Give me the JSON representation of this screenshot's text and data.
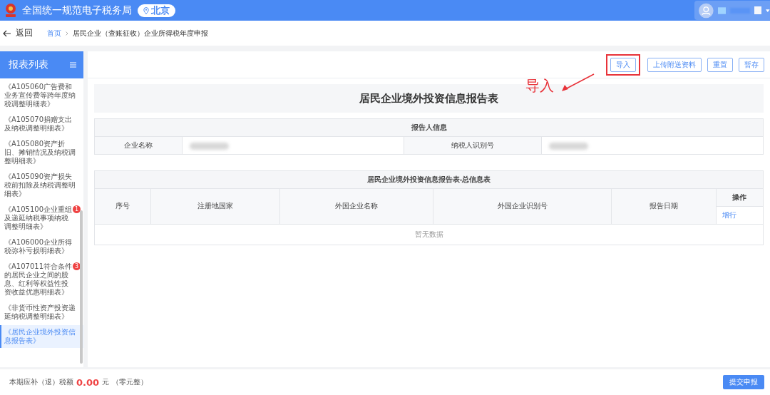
{
  "header": {
    "title": "全国统一规范电子税务局",
    "location": "北京"
  },
  "nav": {
    "back": "返回",
    "breadcrumb": [
      {
        "label": "首页",
        "link": true
      },
      {
        "label": "居民企业（查账征收）企业所得税年度申报",
        "link": false
      }
    ]
  },
  "sidebar": {
    "title": "报表列表",
    "items": [
      {
        "label": "《A105060广告费和业务宣传费等跨年度纳税调整明细表》",
        "selected": false
      },
      {
        "label": "《A105070捐赠支出及纳税调整明细表》",
        "selected": false
      },
      {
        "label": "《A105080资产折旧、摊销情况及纳税调整明细表》",
        "selected": false
      },
      {
        "label": "《A105090资产损失税前扣除及纳税调整明细表》",
        "selected": false
      },
      {
        "label": "《A105100企业重组及递延纳税事项纳税调整明细表》",
        "selected": false,
        "badge": "1"
      },
      {
        "label": "《A106000企业所得税弥补亏损明细表》",
        "selected": false
      },
      {
        "label": "《A107011符合条件的居民企业之间的股息、红利等权益性投资收益优惠明细表》",
        "selected": false,
        "badge": "3"
      },
      {
        "label": "《非货币性资产投资递延纳税调整明细表》",
        "selected": false
      },
      {
        "label": "《居民企业境外投资信息报告表》",
        "selected": true
      }
    ]
  },
  "toolbar": {
    "buttons": [
      {
        "label": "导入",
        "highlighted": true
      },
      {
        "label": "上传附送资料",
        "highlighted": false
      },
      {
        "label": "重置",
        "highlighted": false
      },
      {
        "label": "暂存",
        "highlighted": false
      }
    ]
  },
  "annotation": {
    "label": "导入"
  },
  "form": {
    "title": "居民企业境外投资信息报告表",
    "reporter": {
      "heading": "报告人信息",
      "fields": [
        {
          "label": "企业名称",
          "redacted": true
        },
        {
          "label": "纳税人识别号",
          "redacted": true
        }
      ]
    },
    "summary": {
      "heading": "居民企业境外投资信息报告表-总信息表",
      "columns": [
        "序号",
        "注册地国家",
        "外国企业名称",
        "外国企业识别号",
        "报告日期"
      ],
      "action_header": "操作",
      "action": "增行",
      "empty": "暂无数据"
    }
  },
  "footer": {
    "label": "本期应补（退）税额",
    "amount": "0.00",
    "unit": "元",
    "words": "（零元整）",
    "submit": "提交申报"
  }
}
